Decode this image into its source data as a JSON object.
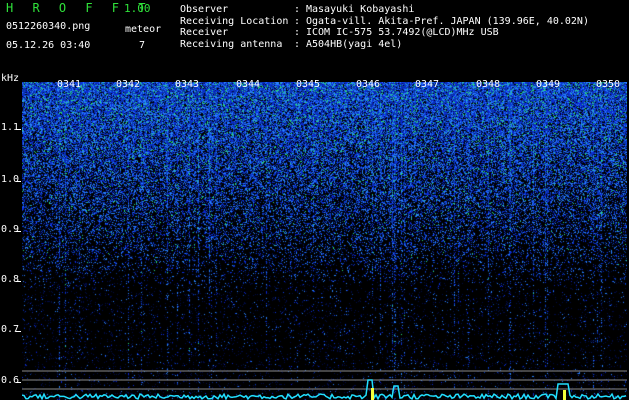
{
  "header": {
    "app_title": "H R O F F T",
    "version": "1.00",
    "filename": "0512260340.png",
    "datetime": "05.12.26 03:40",
    "meteor_label": "meteor",
    "meteor_count": "7"
  },
  "info": [
    {
      "label": "Observer",
      "sep": ":",
      "value": "Masayuki Kobayashi"
    },
    {
      "label": "Receiving Location",
      "sep": ":",
      "value": "Ogata-vill. Akita-Pref. JAPAN (139.96E, 40.02N)"
    },
    {
      "label": "Receiver",
      "sep": ":",
      "value": "ICOM IC-575 53.7492(@LCD)MHz USB"
    },
    {
      "label": "Receiving antenna",
      "sep": ":",
      "value": "A504HB(yagi 4el)"
    }
  ],
  "axis": {
    "y_unit": "kHz",
    "y_ticks": [
      "1.1",
      "1.0",
      "0.9",
      "0.8",
      "0.7",
      "0.6"
    ],
    "x_ticks": [
      "0341",
      "0342",
      "0343",
      "0344",
      "0345",
      "0346",
      "0347",
      "0348",
      "0349",
      "0350"
    ]
  },
  "colors": {
    "background": "#000000",
    "title_green": "#2fe23a",
    "text": "#ffffff",
    "spectrum_cyan": "#22e0ff",
    "spectrum_yellow": "#f2ff3a"
  }
}
